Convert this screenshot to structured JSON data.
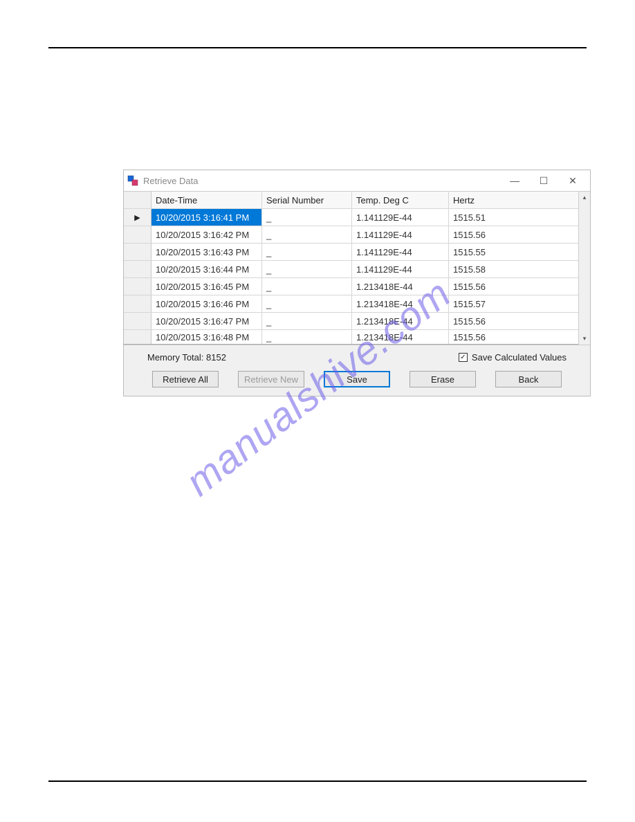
{
  "window": {
    "title": "Retrieve Data"
  },
  "columns": {
    "datetime": "Date-Time",
    "serial": "Serial Number",
    "temp": "Temp. Deg C",
    "hertz": "Hertz"
  },
  "rows": [
    {
      "datetime": "10/20/2015 3:16:41 PM",
      "serial": "_",
      "temp": "1.141129E-44",
      "hertz": "1515.51"
    },
    {
      "datetime": "10/20/2015 3:16:42 PM",
      "serial": "_",
      "temp": "1.141129E-44",
      "hertz": "1515.56"
    },
    {
      "datetime": "10/20/2015 3:16:43 PM",
      "serial": "_",
      "temp": "1.141129E-44",
      "hertz": "1515.55"
    },
    {
      "datetime": "10/20/2015 3:16:44 PM",
      "serial": "_",
      "temp": "1.141129E-44",
      "hertz": "1515.58"
    },
    {
      "datetime": "10/20/2015 3:16:45 PM",
      "serial": "_",
      "temp": "1.213418E-44",
      "hertz": "1515.56"
    },
    {
      "datetime": "10/20/2015 3:16:46 PM",
      "serial": "_",
      "temp": "1.213418E-44",
      "hertz": "1515.57"
    },
    {
      "datetime": "10/20/2015 3:16:47 PM",
      "serial": "_",
      "temp": "1.213418E-44",
      "hertz": "1515.56"
    },
    {
      "datetime": "10/20/2015 3:16:48 PM",
      "serial": "_",
      "temp": "1.213418E-44",
      "hertz": "1515.56"
    }
  ],
  "footer": {
    "memory": "Memory Total: 8152",
    "checkbox_label": "Save Calculated Values",
    "buttons": {
      "retrieve_all": "Retrieve All",
      "retrieve_new": "Retrieve New",
      "save": "Save",
      "erase": "Erase",
      "back": "Back"
    }
  },
  "watermark": "manualshive.com"
}
